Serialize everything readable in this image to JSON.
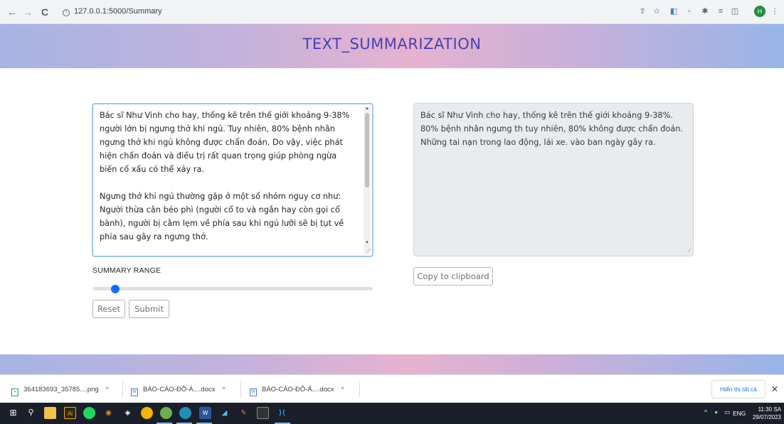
{
  "browser": {
    "url": "127.0.0.1:5000/Summary",
    "back_icon": "←",
    "forward_icon": "→",
    "reload_icon": "C",
    "info_icon": "i",
    "avatar_letter": "H"
  },
  "header": {
    "title": "TEXT_SUMMARIZATION"
  },
  "input": {
    "text": "Bác sĩ Như Vinh cho hay, thống kê trên thế giới khoảng 9-38% người lớn bị ngưng thở khi ngủ. Tuy nhiên, 80% bệnh nhân ngưng thở khi ngủ không được chẩn đoán. Do vậy, việc phát hiện chẩn đoán và điều trị rất quan trọng giúp phòng ngừa biến cố xấu có thể xảy ra.\n\nNgưng thở khi ngủ thường gặp ở một số nhóm nguy cơ như: Người thừa cân béo phì (người cổ to và ngắn hay còn gọi cổ bành), người bị cằm lẹm về phía sau khi ngủ lưỡi sẽ bị tụt về phía sau gây ra ngưng thở.\n\nNgưng thở khi ngủ khiến cho bệnh nhân thường xuyên phải thức"
  },
  "output": {
    "text": "Bác sĩ Như Vinh cho hay, thống kê trên thế giới khoảng 9-38%. 80% bệnh nhân ngưng th  tuy nhiên, 80% không được chẩn đoán. Những tai nạn trong lao động, lái xe. vào ban ngày gây ra."
  },
  "controls": {
    "range_label": "SUMMARY RANGE",
    "range_value_fraction": 0.08,
    "reset_label": "Reset",
    "submit_label": "Submit",
    "copy_label": "Copy to clipboard"
  },
  "downloads": {
    "items": [
      {
        "name": "364183693_35785....png",
        "icon": "image-icon"
      },
      {
        "name": "BÁO-CÁO-ĐỒ-Á....docx",
        "icon": "word-icon"
      },
      {
        "name": "BÁO-CÁO-ĐỒ-Á....docx",
        "icon": "word-icon"
      }
    ],
    "show_all_label": "Hiển thị tất cả",
    "close_icon": "✕"
  },
  "taskbar": {
    "language": "ENG",
    "time": "11:30 SA",
    "date": "29/07/2023"
  },
  "colors": {
    "accent": "#0d6efd",
    "title_color": "#4a3fb0",
    "focus_border": "#9fc4f4",
    "output_bg": "#e9ecef"
  }
}
